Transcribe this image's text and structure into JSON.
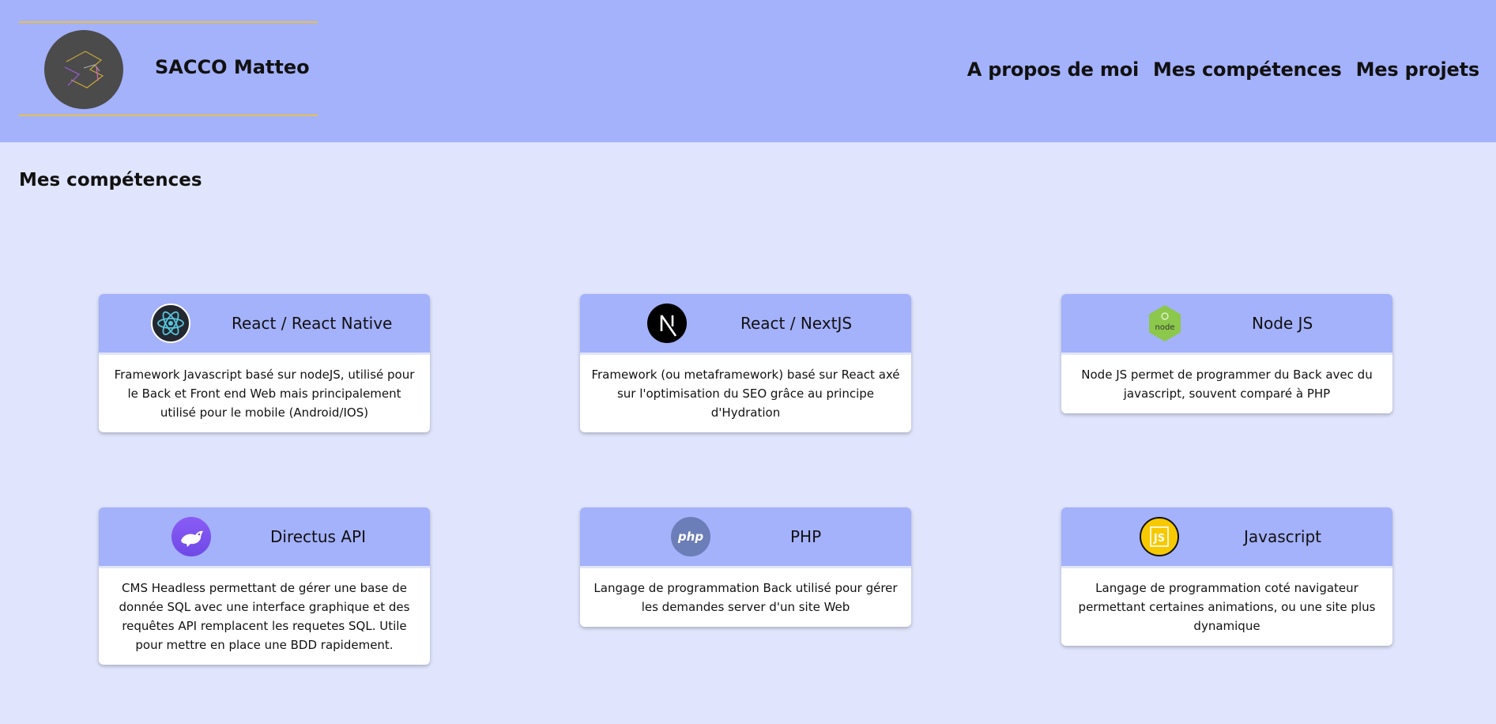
{
  "header": {
    "brand_name": "SACCO Matteo",
    "logo_icon": "monogram-logo-icon",
    "background": "#a4b1fb",
    "accent_line": "#e6c04a"
  },
  "nav": {
    "items": [
      {
        "label": "A propos de moi"
      },
      {
        "label": "Mes compétences"
      },
      {
        "label": "Mes projets"
      }
    ]
  },
  "main": {
    "section_title": "Mes compétences",
    "cards": [
      {
        "title": "React / React Native",
        "icon": "react-icon",
        "description": "Framework Javascript basé sur nodeJS, utilisé pour le Back et Front end Web mais principalement utilisé pour le mobile (Android/IOS)"
      },
      {
        "title": "React / NextJS",
        "icon": "nextjs-icon",
        "description": "Framework (ou metaframework) basé sur React axé sur l'optimisation du SEO grâce au principe d'Hydration"
      },
      {
        "title": "Node JS",
        "icon": "nodejs-icon",
        "description": "Node JS permet de programmer du Back avec du javascript, souvent comparé à PHP"
      },
      {
        "title": "Directus API",
        "icon": "directus-icon",
        "description": "CMS Headless permettant de gérer une base de donnée SQL avec une interface graphique et des requêtes API remplacent les requetes SQL. Utile pour mettre en place une BDD rapidement."
      },
      {
        "title": "PHP",
        "icon": "php-icon",
        "description": "Langage de programmation Back utilisé pour gérer les demandes server d'un site Web"
      },
      {
        "title": "Javascript",
        "icon": "javascript-icon",
        "description": "Langage de programmation coté navigateur permettant certaines animations, ou une site plus dynamique"
      }
    ]
  },
  "colors": {
    "page_background": "#e0e5fd",
    "card_header": "#a4b1fb",
    "card_body": "#ffffff"
  }
}
